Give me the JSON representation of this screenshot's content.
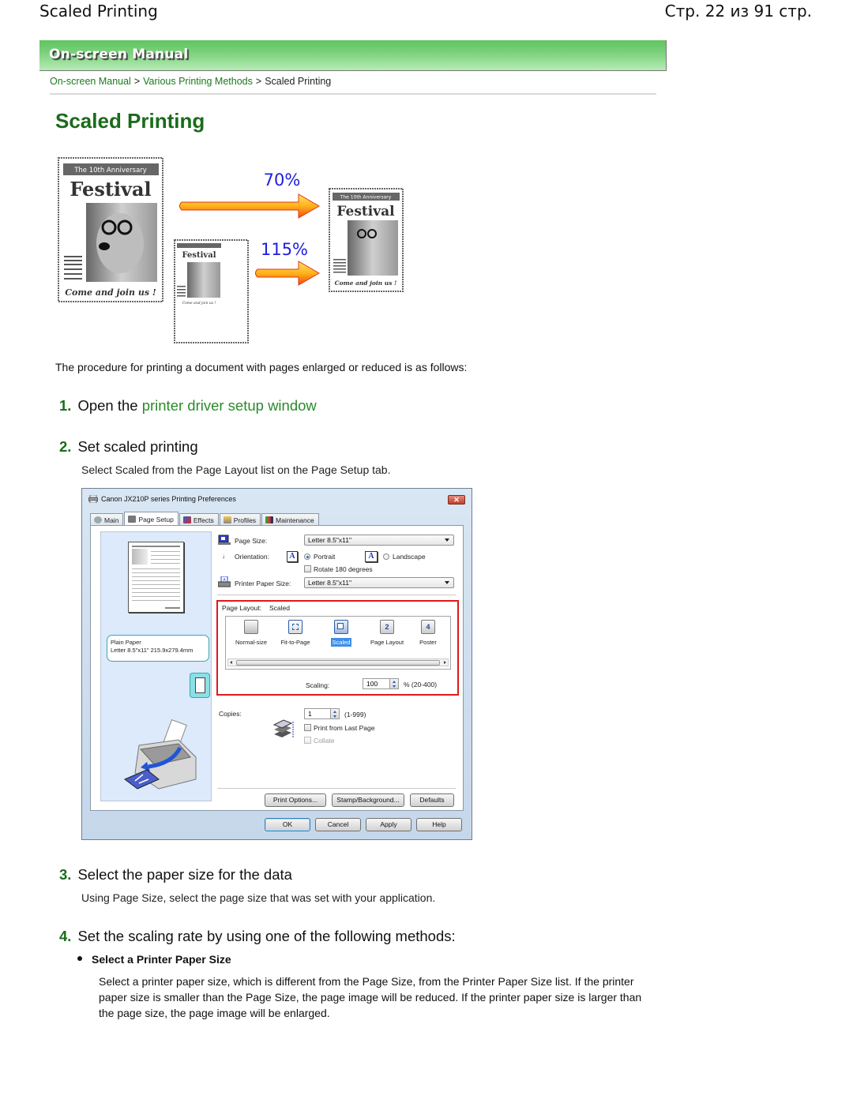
{
  "page": {
    "header_title": "Scaled Printing",
    "page_counter": "Стр. 22 из 91 стр."
  },
  "banner": {
    "title": "On-screen Manual"
  },
  "breadcrumb": {
    "items": [
      {
        "label": "On-screen Manual",
        "link": true
      },
      {
        "label": "Various Printing Methods",
        "link": true
      },
      {
        "label": "Scaled Printing",
        "link": false
      }
    ],
    "separator": ">"
  },
  "heading": "Scaled Printing",
  "figure": {
    "poster_top_label": "The 10th Anniversary",
    "poster_title": "Festival",
    "poster_footer": "Come and join us !",
    "reduce_label": "70%",
    "enlarge_label": "115%"
  },
  "intro": "The procedure for printing a document with pages enlarged or reduced is as follows:",
  "steps": [
    {
      "num": "1.",
      "text": "Open the ",
      "link": "printer driver setup window"
    },
    {
      "num": "2.",
      "text": "Set scaled printing",
      "desc": "Select Scaled from the Page Layout list on the Page Setup tab."
    },
    {
      "num": "3.",
      "text": "Select the paper size for the data",
      "desc": "Using Page Size, select the page size that was set with your application."
    },
    {
      "num": "4.",
      "text": "Set the scaling rate by using one of the following methods:"
    }
  ],
  "dialog": {
    "title": "Canon JX210P series Printing Preferences",
    "close": "✕",
    "tabs": [
      {
        "label": "Main",
        "active": false
      },
      {
        "label": "Page Setup",
        "active": true
      },
      {
        "label": "Effects",
        "active": false
      },
      {
        "label": "Profiles",
        "active": false
      },
      {
        "label": "Maintenance",
        "active": false
      }
    ],
    "paper_info": {
      "line1": "Plain Paper",
      "line2": "Letter 8.5\"x11\" 215.9x279.4mm"
    },
    "page_size": {
      "label": "Page Size:",
      "value": "Letter 8.5\"x11\""
    },
    "orientation": {
      "label": "Orientation:",
      "portrait": "Portrait",
      "landscape": "Landscape",
      "selected": "Portrait",
      "rotate_label": "Rotate 180 degrees",
      "rotate_checked": false
    },
    "printer_paper_size": {
      "label": "Printer Paper Size:",
      "value": "Letter 8.5\"x11\""
    },
    "page_layout": {
      "label": "Page Layout:",
      "value": "Scaled",
      "items": [
        "Normal-size",
        "Fit-to-Page",
        "Scaled",
        "Page Layout",
        "Poster"
      ],
      "selected": "Scaled"
    },
    "scaling": {
      "label": "Scaling:",
      "value": "100",
      "range": "% (20-400)"
    },
    "copies": {
      "label": "Copies:",
      "value": "1",
      "range": "(1-999)"
    },
    "print_from_last_page": {
      "label": "Print from Last Page",
      "checked": false
    },
    "collate": {
      "label": "Collate",
      "checked": false,
      "enabled": false
    },
    "buttons_row1": [
      "Print Options...",
      "Stamp/Background...",
      "Defaults"
    ],
    "buttons_row2": [
      "OK",
      "Cancel",
      "Apply",
      "Help"
    ]
  },
  "method": {
    "title": "Select a Printer Paper Size",
    "desc": "Select a printer paper size, which is different from the Page Size, from the Printer Paper Size list. If the printer paper size is smaller than the Page Size, the page image will be reduced. If the printer paper size is larger than the page size, the page image will be enlarged."
  },
  "colors": {
    "brand_green": "#1a6b1a",
    "link_green": "#2a8a2a",
    "banner_green": "#5fc45f",
    "highlight_red": "#e01818",
    "percent_blue": "#1e1ee0"
  }
}
